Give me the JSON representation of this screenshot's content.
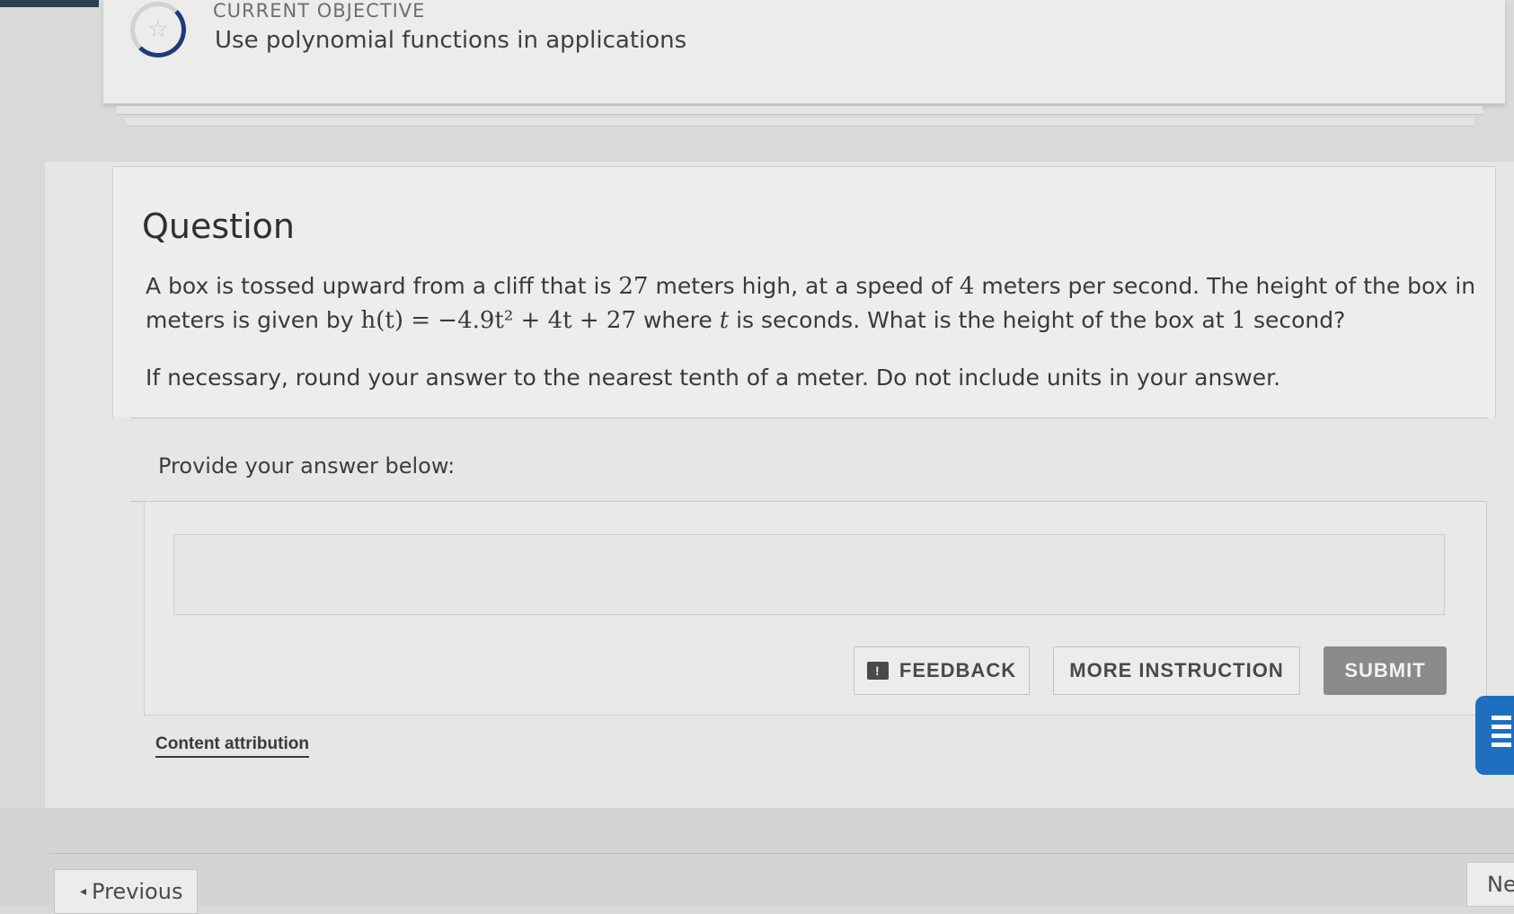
{
  "objective": {
    "label": "CURRENT OBJECTIVE",
    "title": "Use polynomial functions in applications",
    "icon": "star-icon"
  },
  "question": {
    "heading": "Question",
    "p1_a": "A box is tossed upward from a cliff that is ",
    "p1_height": "27",
    "p1_b": " meters high, at a speed of ",
    "p1_speed": "4",
    "p1_c": " meters per second. The height of the box in meters is given by ",
    "p1_formula": "h(t) = −4.9t² + 4t + 27",
    "p1_d": " where ",
    "p1_var": "t",
    "p1_e": " is seconds. What is the height of the box at ",
    "p1_time": "1",
    "p1_f": " second?",
    "p2": "If necessary, round your answer to the nearest tenth of a meter. Do not include units in your answer."
  },
  "answer": {
    "label": "Provide your answer below:",
    "value": "",
    "placeholder": ""
  },
  "buttons": {
    "feedback": "FEEDBACK",
    "more_instruction": "MORE INSTRUCTION",
    "submit": "SUBMIT"
  },
  "attribution": "Content attribution",
  "nav": {
    "previous": "Previous",
    "next": "Ne"
  },
  "colors": {
    "accent_blue": "#1f6fc0",
    "submit_gray": "#8a8a88",
    "ring_blue": "#1f3a7a"
  }
}
